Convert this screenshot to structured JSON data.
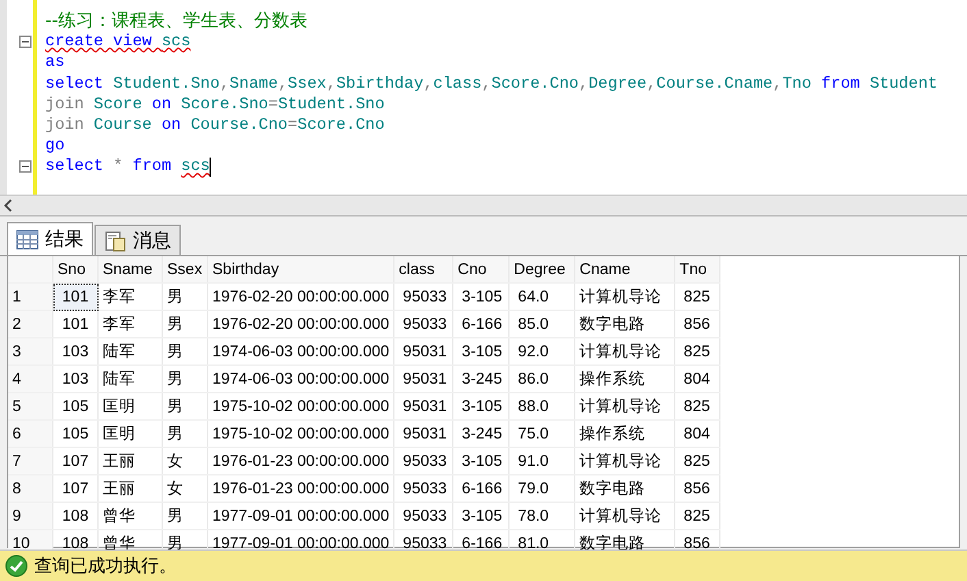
{
  "editor": {
    "lines": [
      {
        "tokens": [
          {
            "kind": "comment",
            "text": "--练习：课程表、学生表、分数表"
          }
        ]
      },
      {
        "expanded": true,
        "tokens": [
          {
            "kind": "keyword",
            "text": "create view ",
            "squiggle": true
          },
          {
            "kind": "name",
            "text": "scs",
            "squiggle": true
          }
        ]
      },
      {
        "tokens": [
          {
            "kind": "keyword",
            "text": "as"
          }
        ]
      },
      {
        "tokens": [
          {
            "kind": "keyword",
            "text": "select "
          },
          {
            "kind": "name",
            "text": "Student.Sno"
          },
          {
            "kind": "operator",
            "text": ","
          },
          {
            "kind": "name",
            "text": "Sname"
          },
          {
            "kind": "operator",
            "text": ","
          },
          {
            "kind": "name",
            "text": "Ssex"
          },
          {
            "kind": "operator",
            "text": ","
          },
          {
            "kind": "name",
            "text": "Sbirthday"
          },
          {
            "kind": "operator",
            "text": ","
          },
          {
            "kind": "name",
            "text": "class"
          },
          {
            "kind": "operator",
            "text": ","
          },
          {
            "kind": "name",
            "text": "Score.Cno"
          },
          {
            "kind": "operator",
            "text": ","
          },
          {
            "kind": "name",
            "text": "Degree"
          },
          {
            "kind": "operator",
            "text": ","
          },
          {
            "kind": "name",
            "text": "Course.Cname"
          },
          {
            "kind": "operator",
            "text": ","
          },
          {
            "kind": "name",
            "text": "Tno "
          },
          {
            "kind": "keyword",
            "text": "from "
          },
          {
            "kind": "name",
            "text": "Student"
          }
        ]
      },
      {
        "tokens": [
          {
            "kind": "operator",
            "text": "join "
          },
          {
            "kind": "name",
            "text": "Score "
          },
          {
            "kind": "keyword",
            "text": "on "
          },
          {
            "kind": "name",
            "text": "Score.Sno"
          },
          {
            "kind": "operator",
            "text": "="
          },
          {
            "kind": "name",
            "text": "Student.Sno"
          }
        ]
      },
      {
        "tokens": [
          {
            "kind": "operator",
            "text": "join "
          },
          {
            "kind": "name",
            "text": "Course "
          },
          {
            "kind": "keyword",
            "text": "on "
          },
          {
            "kind": "name",
            "text": "Course.Cno"
          },
          {
            "kind": "operator",
            "text": "="
          },
          {
            "kind": "name",
            "text": "Score.Cno"
          }
        ]
      },
      {
        "tokens": [
          {
            "kind": "keyword",
            "text": "go"
          }
        ]
      },
      {
        "expanded": true,
        "caret": true,
        "tokens": [
          {
            "kind": "keyword",
            "text": "select "
          },
          {
            "kind": "operator",
            "text": "* "
          },
          {
            "kind": "keyword",
            "text": "from "
          },
          {
            "kind": "name",
            "text": "scs",
            "squiggle": true
          }
        ]
      }
    ]
  },
  "tabs": [
    {
      "label": "结果",
      "selected": true
    },
    {
      "label": "消息",
      "selected": false
    }
  ],
  "results": {
    "columns": [
      "Sno",
      "Sname",
      "Ssex",
      "Sbirthday",
      "class",
      "Cno",
      "Degree",
      "Cname",
      "Tno"
    ],
    "rows": [
      {
        "number": "1",
        "selected": true,
        "cells": [
          "101",
          "李军",
          "男",
          "1976-02-20 00:00:00.000",
          "95033",
          "3-105",
          "64.0",
          "计算机导论",
          "825"
        ]
      },
      {
        "number": "2",
        "selected": false,
        "cells": [
          "101",
          "李军",
          "男",
          "1976-02-20 00:00:00.000",
          "95033",
          "6-166",
          "85.0",
          "数字电路",
          "856"
        ]
      },
      {
        "number": "3",
        "selected": false,
        "cells": [
          "103",
          "陆军",
          "男",
          "1974-06-03 00:00:00.000",
          "95031",
          "3-105",
          "92.0",
          "计算机导论",
          "825"
        ]
      },
      {
        "number": "4",
        "selected": false,
        "cells": [
          "103",
          "陆军",
          "男",
          "1974-06-03 00:00:00.000",
          "95031",
          "3-245",
          "86.0",
          "操作系统",
          "804"
        ]
      },
      {
        "number": "5",
        "selected": false,
        "cells": [
          "105",
          "匡明",
          "男",
          "1975-10-02 00:00:00.000",
          "95031",
          "3-105",
          "88.0",
          "计算机导论",
          "825"
        ]
      },
      {
        "number": "6",
        "selected": false,
        "cells": [
          "105",
          "匡明",
          "男",
          "1975-10-02 00:00:00.000",
          "95031",
          "3-245",
          "75.0",
          "操作系统",
          "804"
        ]
      },
      {
        "number": "7",
        "selected": false,
        "cells": [
          "107",
          "王丽",
          "女",
          "1976-01-23 00:00:00.000",
          "95033",
          "3-105",
          "91.0",
          "计算机导论",
          "825"
        ]
      },
      {
        "number": "8",
        "selected": false,
        "cells": [
          "107",
          "王丽",
          "女",
          "1976-01-23 00:00:00.000",
          "95033",
          "6-166",
          "79.0",
          "数字电路",
          "856"
        ]
      },
      {
        "number": "9",
        "selected": false,
        "cells": [
          "108",
          "曾华",
          "男",
          "1977-09-01 00:00:00.000",
          "95033",
          "3-105",
          "78.0",
          "计算机导论",
          "825"
        ]
      },
      {
        "number": "10",
        "selected": false,
        "cells": [
          "108",
          "曾华",
          "男",
          "1977-09-01 00:00:00.000",
          "95033",
          "6-166",
          "81.0",
          "数字电路",
          "856"
        ]
      }
    ]
  },
  "status_bar": {
    "kind": "success",
    "text": "查询已成功执行。"
  }
}
